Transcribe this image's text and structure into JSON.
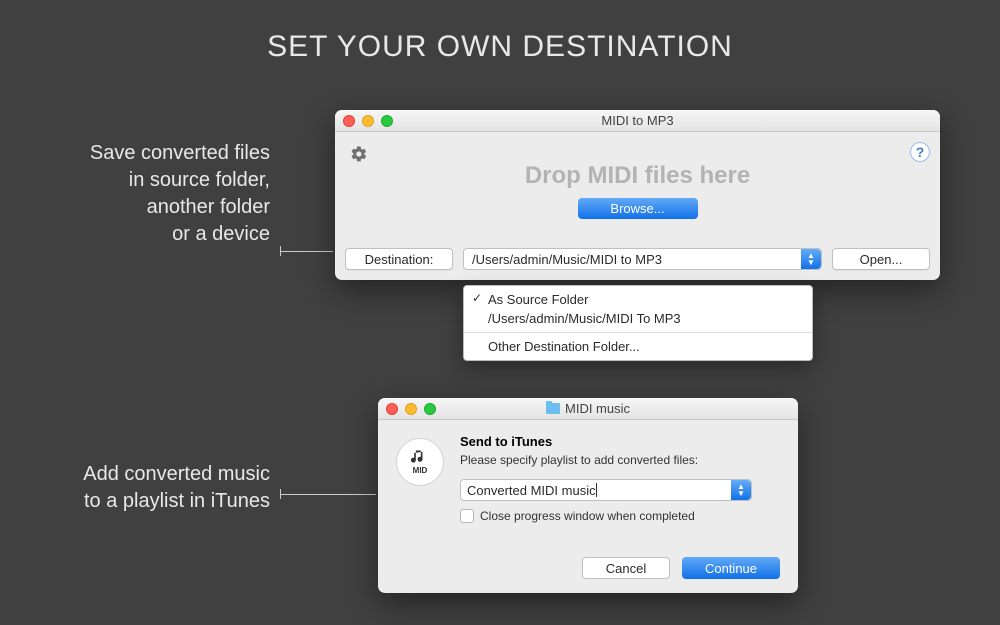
{
  "page": {
    "title": "SET YOUR OWN DESTINATION",
    "caption1": "Save converted files\nin source folder,\nanother folder\nor a device",
    "caption2": "Add converted music\nto a playlist in iTunes"
  },
  "window1": {
    "title": "MIDI to MP3",
    "drop_text": "Drop MIDI files here",
    "browse": "Browse...",
    "destination_label": "Destination:",
    "destination_value": "/Users/admin/Music/MIDI to MP3",
    "open": "Open...",
    "help": "?"
  },
  "dropdown": {
    "items": [
      "As Source Folder",
      "/Users/admin/Music/MIDI To MP3",
      "Other Destination Folder..."
    ]
  },
  "window2": {
    "title": "MIDI music",
    "dialog_title": "Send to iTunes",
    "instruction": "Please specify playlist to add converted files:",
    "playlist_value": "Converted MIDI music",
    "checkbox_label": "Close progress window when completed",
    "cancel": "Cancel",
    "continue": "Continue",
    "mid_label": "MID"
  }
}
